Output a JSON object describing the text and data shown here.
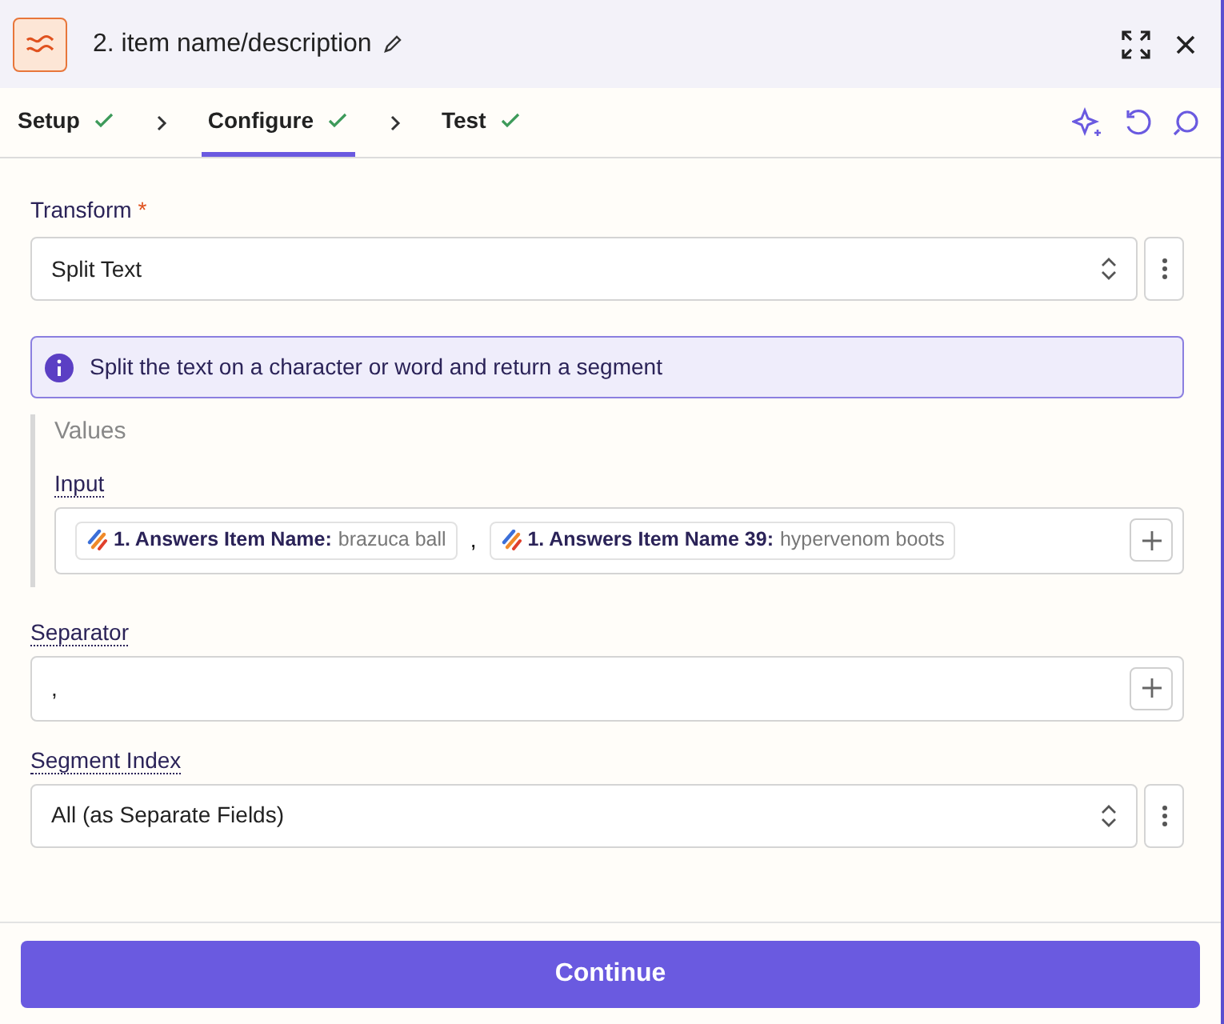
{
  "header": {
    "title": "2. item name/description"
  },
  "tabs": [
    {
      "label": "Setup",
      "done": true,
      "selected": false
    },
    {
      "label": "Configure",
      "done": true,
      "selected": true
    },
    {
      "label": "Test",
      "done": true,
      "selected": false
    }
  ],
  "fields": [
    {
      "kind": "select",
      "label": "Transform",
      "required_mark": "*",
      "value": "Split Text"
    },
    {
      "kind": "info",
      "text": "Split the text on a character or word and return a segment"
    },
    {
      "kind": "group",
      "label": "Values",
      "children": [
        {
          "kind": "tokens",
          "label": "Input",
          "tokens": [
            {
              "name": "1. Answers Item Name:",
              "value": "brazuca ball"
            },
            {
              "name": "1. Answers Item Name 39:",
              "value": "hypervenom boots"
            }
          ],
          "joiner": ","
        }
      ]
    },
    {
      "kind": "text",
      "label": "Separator",
      "value": ","
    },
    {
      "kind": "select",
      "label": "Segment Index",
      "value": "All (as Separate Fields)"
    }
  ],
  "continue_button": "Continue"
}
